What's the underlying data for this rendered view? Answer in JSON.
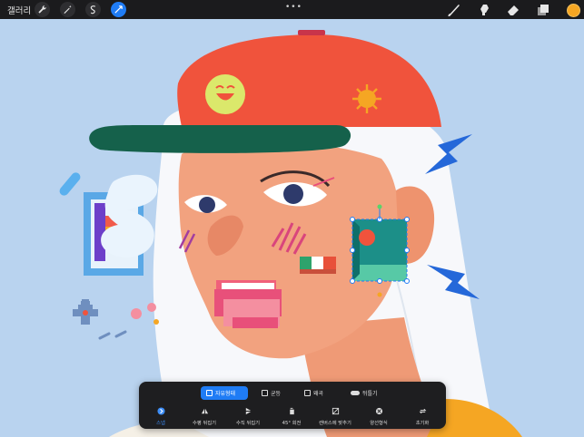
{
  "topbar": {
    "gallery_label": "갤러리",
    "left_tools": [
      "wrench-icon",
      "magic-wand-icon",
      "selection-icon",
      "transform-icon"
    ],
    "menu_dots": "•••",
    "right_tools": [
      "brush-icon",
      "smudge-icon",
      "eraser-icon",
      "layers-icon"
    ],
    "current_color": "#f5a623"
  },
  "transform_panel": {
    "modes": [
      {
        "label": "자유형태",
        "selected": true
      },
      {
        "label": "균등",
        "selected": false
      },
      {
        "label": "왜곡",
        "selected": false
      },
      {
        "label": "뒤틀기",
        "selected": false
      }
    ],
    "actions": [
      {
        "label": "스냅",
        "icon": "snap-icon",
        "active": true
      },
      {
        "label": "수평 뒤집기",
        "icon": "flip-horizontal-icon",
        "active": false
      },
      {
        "label": "수직 뒤집기",
        "icon": "flip-vertical-icon",
        "active": false
      },
      {
        "label": "45° 회전",
        "icon": "rotate-icon",
        "active": false
      },
      {
        "label": "캔버스에 맞추기",
        "icon": "fit-canvas-icon",
        "active": false
      },
      {
        "label": "양선형식",
        "icon": "interpolation-icon",
        "active": false
      },
      {
        "label": "초기화",
        "icon": "reset-icon",
        "active": false
      }
    ]
  },
  "colors": {
    "accent": "#1f7cf5",
    "canvas_bg": "#b9d3ef",
    "cap": "#f0533c"
  }
}
